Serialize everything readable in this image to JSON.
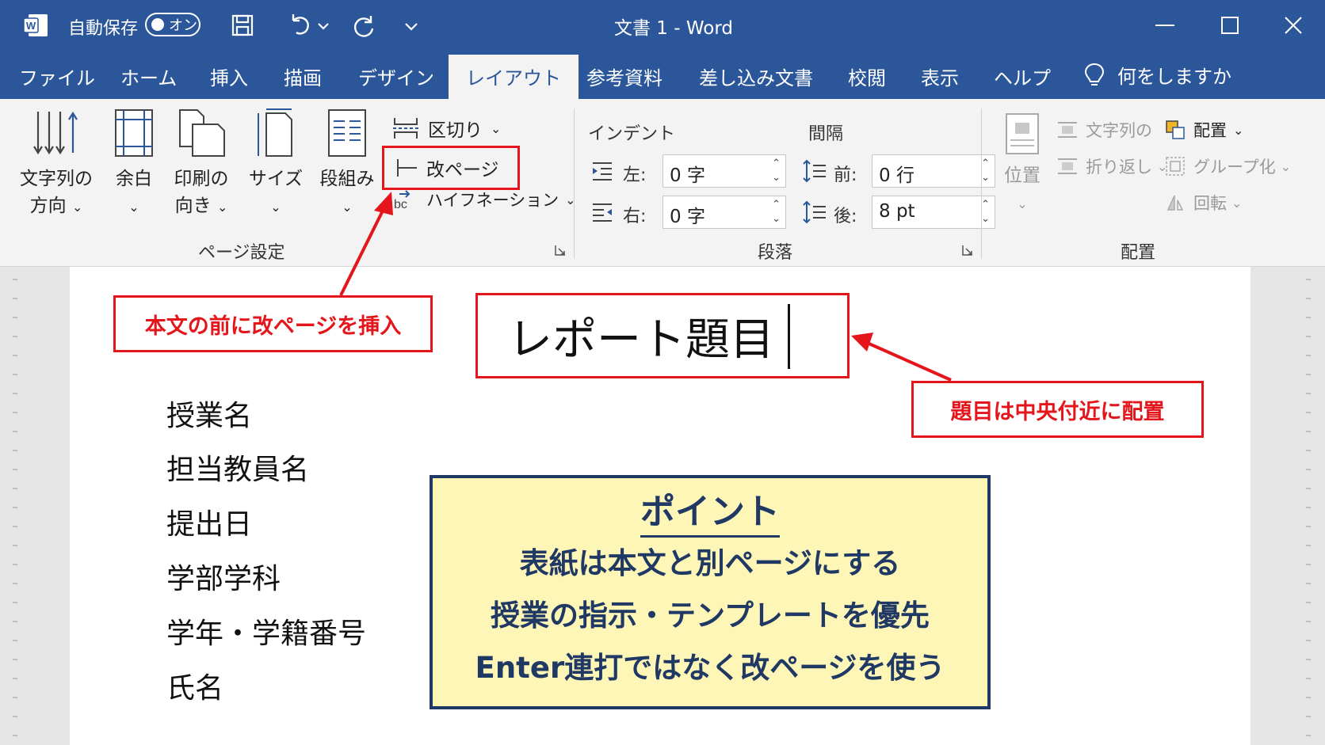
{
  "titlebar": {
    "autosave_label": "自動保存",
    "autosave_toggle": "オン",
    "document_title": "文書 1 - Word"
  },
  "tabs": [
    {
      "label": "ファイル"
    },
    {
      "label": "ホーム"
    },
    {
      "label": "挿入"
    },
    {
      "label": "描画"
    },
    {
      "label": "デザイン"
    },
    {
      "label": "レイアウト",
      "active": true
    },
    {
      "label": "参考資料"
    },
    {
      "label": "差し込み文書"
    },
    {
      "label": "校閲"
    },
    {
      "label": "表示"
    },
    {
      "label": "ヘルプ"
    }
  ],
  "tell_me": "何をしますか",
  "ribbon": {
    "page_setup": {
      "group_label": "ページ設定",
      "text_direction": {
        "line1": "文字列の",
        "line2": "方向"
      },
      "margins": "余白",
      "orientation": {
        "line1": "印刷の",
        "line2": "向き"
      },
      "size": "サイズ",
      "columns": "段組み",
      "breaks": "区切り",
      "page_break": "改ページ",
      "hyphenation": "ハイフネーション"
    },
    "paragraph": {
      "group_label": "段落",
      "indent_heading": "インデント",
      "spacing_heading": "間隔",
      "indent_left_label": "左:",
      "indent_left_value": "0 字",
      "indent_right_label": "右:",
      "indent_right_value": "0 字",
      "spacing_before_label": "前:",
      "spacing_before_value": "0 行",
      "spacing_after_label": "後:",
      "spacing_after_value": "8 pt"
    },
    "arrange": {
      "group_label": "配置",
      "position": "位置",
      "wrap_text_top": "文字列の",
      "wrap_text": "折り返し",
      "arrange_menu": "配置",
      "group": "グループ化",
      "rotate": "回転"
    }
  },
  "document": {
    "title": "レポート題目",
    "cover_items": [
      "授業名",
      "担当教員名",
      "提出日",
      "学部学科",
      "学年・学籍番号",
      "氏名"
    ]
  },
  "annotations": {
    "page_break_note": "本文の前に改ページを挿入",
    "title_note": "題目は中央付近に配置",
    "point_box": {
      "title": "ポイント",
      "lines": [
        "表紙は本文と別ページにする",
        "授業の指示・テンプレートを優先",
        "Enter連打ではなく改ページを使う"
      ]
    }
  },
  "colors": {
    "brand": "#2b579a",
    "callout_red": "#e4161c",
    "point_bg": "#fef6b7",
    "point_text": "#1f3864"
  }
}
